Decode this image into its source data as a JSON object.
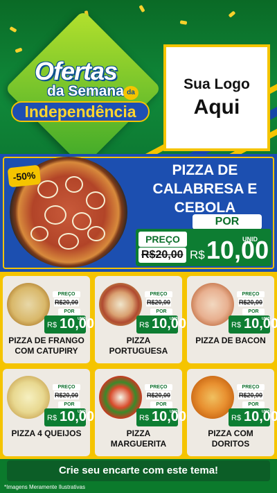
{
  "header": {
    "title_line1": "Ofertas",
    "title_line2": "da Semana",
    "title_badge": "da",
    "title_line3": "Independência",
    "logo_line1": "Sua Logo",
    "logo_line2": "Aqui"
  },
  "featured": {
    "discount": "-50%",
    "name_line1": "PIZZA DE",
    "name_line2": "CALABRESA E",
    "name_line3": "CEBOLA",
    "por_label": "POR",
    "preco_label": "PREÇO",
    "old_price": "R$20,00",
    "currency": "R$",
    "price": "10,00",
    "unit": "UNID"
  },
  "products": [
    {
      "name_l1": "PIZZA DE FRANGO",
      "name_l2": "COM CATUPIRY",
      "preco_label": "PREÇO",
      "old_price": "R$20,00",
      "por_label": "POR",
      "currency": "R$",
      "price": "10,00",
      "unit": "UNID"
    },
    {
      "name_l1": "PIZZA",
      "name_l2": "PORTUGUESA",
      "preco_label": "PREÇO",
      "old_price": "R$20,00",
      "por_label": "POR",
      "currency": "R$",
      "price": "10,00",
      "unit": "UNID"
    },
    {
      "name_l1": "PIZZA DE BACON",
      "name_l2": "",
      "preco_label": "PREÇO",
      "old_price": "R$20,00",
      "por_label": "POR",
      "currency": "R$",
      "price": "10,00",
      "unit": "UNID"
    },
    {
      "name_l1": "PIZZA 4 QUEIJOS",
      "name_l2": "",
      "preco_label": "PREÇO",
      "old_price": "R$20,00",
      "por_label": "POR",
      "currency": "R$",
      "price": "10,00",
      "unit": "UNID"
    },
    {
      "name_l1": "PIZZA",
      "name_l2": "MARGUERITA",
      "preco_label": "PREÇO",
      "old_price": "R$20,00",
      "por_label": "POR",
      "currency": "R$",
      "price": "10,00",
      "unit": "UNID"
    },
    {
      "name_l1": "PIZZA COM",
      "name_l2": "DORITOS",
      "preco_label": "PREÇO",
      "old_price": "R$20,00",
      "por_label": "POR",
      "currency": "R$",
      "price": "10,00",
      "unit": "UNID"
    }
  ],
  "footer": {
    "cta": "Crie seu encarte com este tema!",
    "disclaimer": "*Imagens Meramente Ilustrativas"
  },
  "colors": {
    "green": "#0d7d32",
    "yellow": "#f5c400",
    "blue": "#1c4fb0"
  }
}
